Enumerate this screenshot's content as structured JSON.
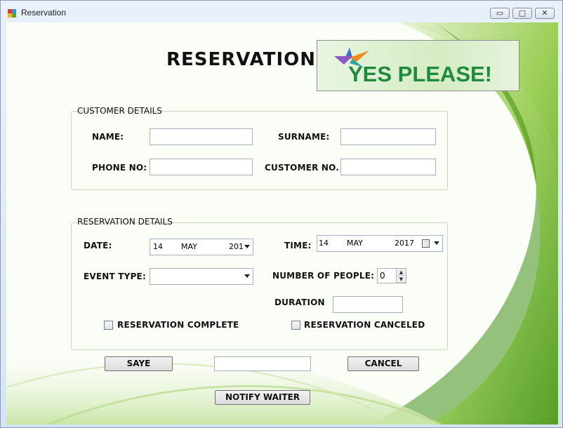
{
  "window": {
    "title": "Reservation",
    "controls": {
      "minimize": "▭",
      "maximize": "□",
      "close": "✕"
    }
  },
  "header": {
    "title": "RESERVATION"
  },
  "logo": {
    "text": "YES PLEASE!"
  },
  "customer": {
    "group_title": "CUSTOMER DETAILS",
    "name_label": "NAME:",
    "surname_label": "SURNAME:",
    "phone_label": "PHONE NO:",
    "customer_no_label": "CUSTOMER NO.",
    "name_value": "",
    "surname_value": "",
    "phone_value": "",
    "customer_no_value": ""
  },
  "reservation": {
    "group_title": "RESERVATION DETAILS",
    "date_label": "DATE:",
    "date_day": "14",
    "date_month": "MAY",
    "date_year": "201",
    "time_label": "TIME:",
    "time_day": "14",
    "time_month": "MAY",
    "time_year": "2017",
    "event_type_label": "EVENT TYPE:",
    "event_type_value": "",
    "people_label": "NUMBER OF PEOPLE:",
    "people_value": "0",
    "duration_label": "DURATION",
    "duration_value": "",
    "complete_label": "RESERVATION COMPLETE",
    "canceled_label": "RESERVATION CANCELED"
  },
  "actions": {
    "save_label": "SAYE",
    "cancel_label": "CANCEL",
    "notify_label": "NOTIFY WAITER",
    "status_value": ""
  },
  "icons": {
    "app": "app-icon",
    "calendar": "calendar-icon",
    "dropdown": "chevron-down-icon"
  },
  "colors": {
    "logo_green": "#1f8a3b",
    "background_green": "#8cc63f"
  }
}
